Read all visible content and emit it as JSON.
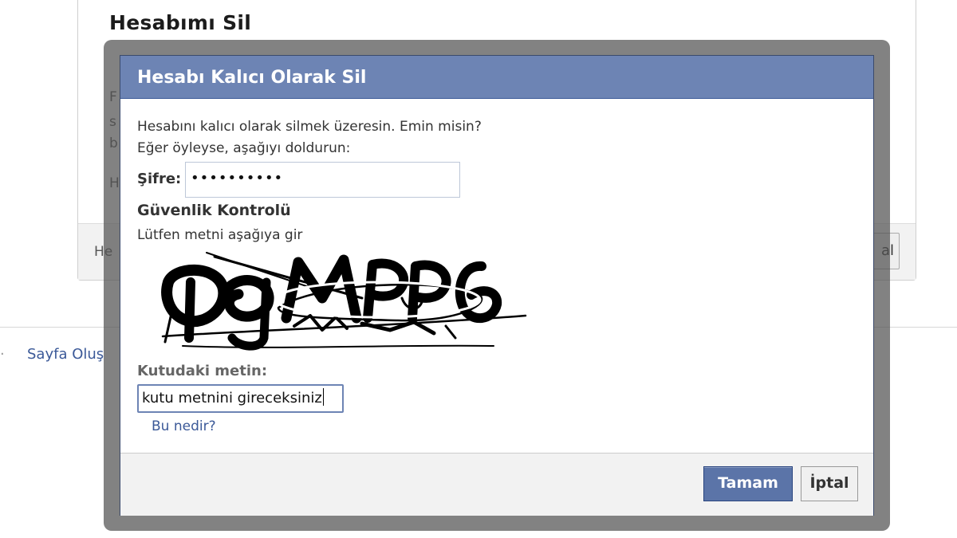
{
  "background": {
    "title": "Hesabımı Sil",
    "clipped_lines": [
      "F",
      "s",
      "b",
      "H"
    ],
    "footer_text": "He",
    "footer_button": "al",
    "footer_link": "Sayfa Oluş",
    "footer_link_prefix": "·"
  },
  "dialog": {
    "title": "Hesabı Kalıcı Olarak Sil",
    "line1": "Hesabını kalıcı olarak silmek üzeresin. Emin misin?",
    "line2": "Eğer öyleyse, aşağıyı doldurun:",
    "password_label": "Şifre:",
    "password_value": "••••••••••",
    "security_title": "Güvenlik Kontrolü",
    "security_instruction": "Lütfen metni aşağıya gir",
    "captcha_label": "Kutudaki metin:",
    "captcha_value": "kutu metnini gireceksiniz",
    "help_link": "Bu nedir?",
    "ok_button": "Tamam",
    "cancel_button": "İptal"
  },
  "colors": {
    "header": "#6d84b4",
    "link": "#3b5998",
    "ok_button": "#5b74a8"
  }
}
